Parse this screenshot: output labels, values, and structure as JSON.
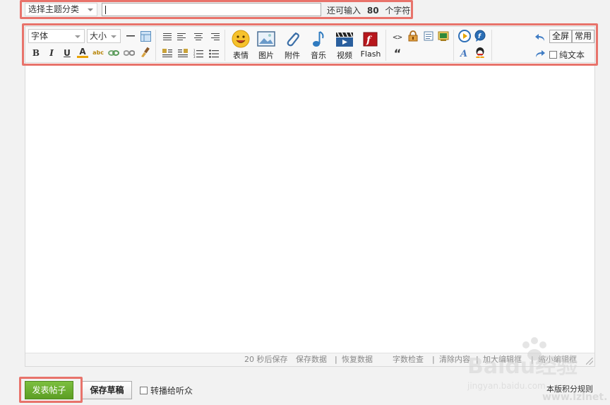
{
  "top": {
    "category_select": "选择主题分类",
    "remain_prefix": "还可输入",
    "remain_count": "80",
    "remain_suffix": "个字符"
  },
  "toolbar": {
    "font": "字体",
    "size": "大小",
    "bold": "B",
    "italic": "I",
    "underline": "U",
    "text_color": "A",
    "spell": "abc",
    "media": [
      {
        "label": "表情",
        "icon": "smiley-icon"
      },
      {
        "label": "图片",
        "icon": "image-icon"
      },
      {
        "label": "附件",
        "icon": "paperclip-icon"
      },
      {
        "label": "音乐",
        "icon": "music-note-icon"
      },
      {
        "label": "视频",
        "icon": "video-icon"
      },
      {
        "label": "Flash",
        "icon": "flash-icon"
      }
    ],
    "code": "<>",
    "quote": "“",
    "fullscreen": "全屏",
    "common": "常用",
    "plain_text": "纯文本"
  },
  "status_bar": {
    "autosave": "20 秒后保存",
    "save_data": "保存数据",
    "restore": "恢复数据",
    "word_check": "字数检查",
    "clear": "清除内容",
    "expand": "加大编辑框",
    "shrink": "缩小编辑框",
    "divider": "|"
  },
  "bottom": {
    "submit": "发表帖子",
    "draft": "保存草稿",
    "broadcast": "转播给听众",
    "rules": "本版积分规则"
  },
  "watermark": {
    "brand": "Baidu经验",
    "url": "jingyan.baidu.com",
    "site": "www.lzlnet.net"
  }
}
